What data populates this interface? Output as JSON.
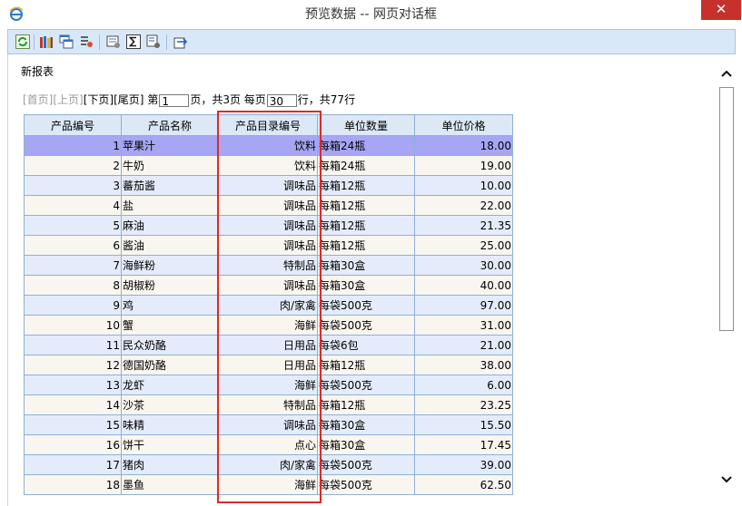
{
  "window": {
    "title": "预览数据 -- 网页对话框",
    "close_glyph": "✕"
  },
  "toolbar": {
    "buttons": [
      "refresh-icon",
      "books-icon",
      "windows-icon",
      "list-settings-icon",
      "print-settings-icon",
      "sum-icon",
      "query-settings-icon",
      "export-icon"
    ]
  },
  "report": {
    "name": "新报表"
  },
  "pager": {
    "first": "[首页]",
    "prev": "[上页]",
    "next": "[下页]",
    "last": "[尾页]",
    "page_prefix": "第",
    "page_value": "1",
    "page_suffix": "页，共3页 每页",
    "size_value": "30",
    "size_suffix": "行，共77行"
  },
  "table": {
    "columns": [
      "产品编号",
      "产品名称",
      "产品目录编号",
      "单位数量",
      "单位价格"
    ],
    "rows": [
      [
        "1",
        "苹果汁",
        "饮料",
        "每箱24瓶",
        "18.00"
      ],
      [
        "2",
        "牛奶",
        "饮料",
        "每箱24瓶",
        "19.00"
      ],
      [
        "3",
        "蕃茄酱",
        "调味品",
        "每箱12瓶",
        "10.00"
      ],
      [
        "4",
        "盐",
        "调味品",
        "每箱12瓶",
        "22.00"
      ],
      [
        "5",
        "麻油",
        "调味品",
        "每箱12瓶",
        "21.35"
      ],
      [
        "6",
        "酱油",
        "调味品",
        "每箱12瓶",
        "25.00"
      ],
      [
        "7",
        "海鲜粉",
        "特制品",
        "每箱30盒",
        "30.00"
      ],
      [
        "8",
        "胡椒粉",
        "调味品",
        "每箱30盒",
        "40.00"
      ],
      [
        "9",
        "鸡",
        "肉/家禽",
        "每袋500克",
        "97.00"
      ],
      [
        "10",
        "蟹",
        "海鲜",
        "每袋500克",
        "31.00"
      ],
      [
        "11",
        "民众奶酪",
        "日用品",
        "每袋6包",
        "21.00"
      ],
      [
        "12",
        "德国奶酪",
        "日用品",
        "每箱12瓶",
        "38.00"
      ],
      [
        "13",
        "龙虾",
        "海鲜",
        "每袋500克",
        "6.00"
      ],
      [
        "14",
        "沙茶",
        "特制品",
        "每箱12瓶",
        "23.25"
      ],
      [
        "15",
        "味精",
        "调味品",
        "每箱30盒",
        "15.50"
      ],
      [
        "16",
        "饼干",
        "点心",
        "每箱30盒",
        "17.45"
      ],
      [
        "17",
        "猪肉",
        "肉/家禽",
        "每袋500克",
        "39.00"
      ],
      [
        "18",
        "墨鱼",
        "海鲜",
        "每袋500克",
        "62.50"
      ]
    ]
  },
  "colors": {
    "selected_row": "#a6a6f4",
    "highlight_box": "#e02828",
    "toolbar_bg": "#d9e8f8",
    "close_button": "#c7312b"
  }
}
